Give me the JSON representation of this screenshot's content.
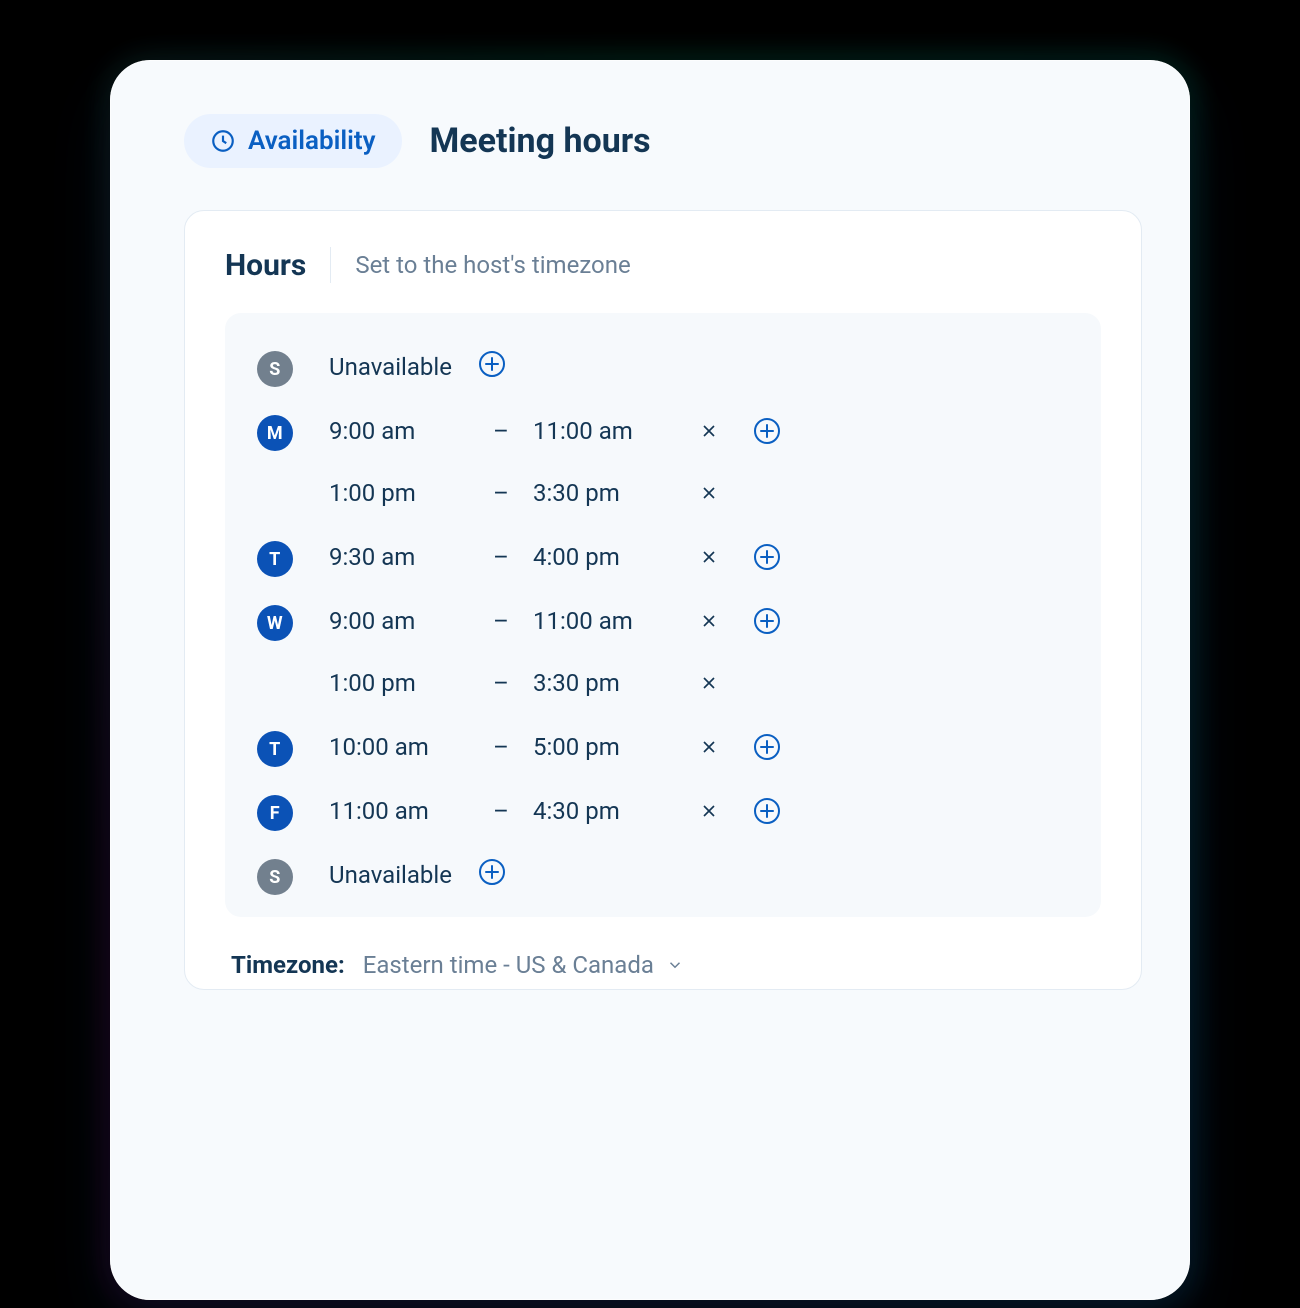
{
  "colors": {
    "blue": "#0a5fc2",
    "navy": "#143654",
    "badge_active": "#0b52b6",
    "badge_inactive": "#72808e"
  },
  "header": {
    "pill_label": "Availability",
    "title": "Meeting hours"
  },
  "panel": {
    "title": "Hours",
    "subtitle": "Set to the host's timezone"
  },
  "timezone": {
    "label": "Timezone:",
    "value": "Eastern time - US & Canada"
  },
  "days": [
    {
      "letter": "S",
      "active": false,
      "unavailable_label": "Unavailable",
      "slots": []
    },
    {
      "letter": "M",
      "active": true,
      "slots": [
        {
          "start": "9:00 am",
          "end": "11:00 am",
          "show_add": true
        },
        {
          "start": "1:00 pm",
          "end": "3:30 pm",
          "show_add": false
        }
      ]
    },
    {
      "letter": "T",
      "active": true,
      "slots": [
        {
          "start": "9:30 am",
          "end": "4:00 pm",
          "show_add": true
        }
      ]
    },
    {
      "letter": "W",
      "active": true,
      "slots": [
        {
          "start": "9:00 am",
          "end": "11:00 am",
          "show_add": true
        },
        {
          "start": "1:00 pm",
          "end": "3:30 pm",
          "show_add": false
        }
      ]
    },
    {
      "letter": "T",
      "active": true,
      "slots": [
        {
          "start": "10:00 am",
          "end": "5:00 pm",
          "show_add": true
        }
      ]
    },
    {
      "letter": "F",
      "active": true,
      "slots": [
        {
          "start": "11:00 am",
          "end": "4:30 pm",
          "show_add": true
        }
      ]
    },
    {
      "letter": "S",
      "active": false,
      "unavailable_label": "Unavailable",
      "slots": []
    }
  ]
}
